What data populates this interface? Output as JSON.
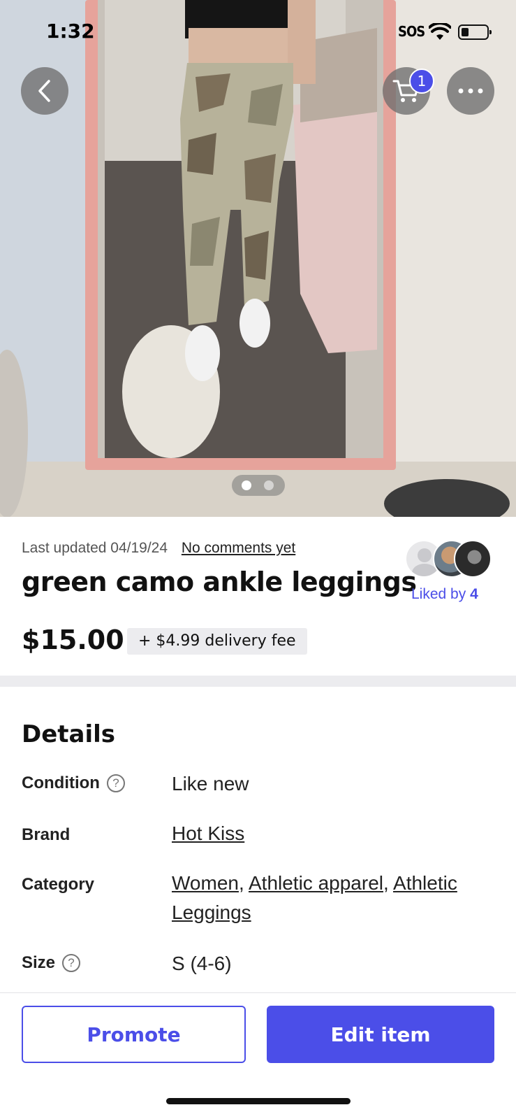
{
  "status_bar": {
    "time": "1:32",
    "sos": "SOS",
    "icons": [
      "wifi-icon",
      "battery-icon"
    ]
  },
  "photo": {
    "icons": {
      "back": "chevron-left-icon",
      "cart": "cart-icon",
      "more": "more-icon"
    },
    "cart_count": "1",
    "pager": {
      "count": 2,
      "active_index": 0
    }
  },
  "listing": {
    "last_updated": "Last updated 04/19/24",
    "comments": "No comments yet",
    "title": "green camo ankle leggings",
    "price": "$15.00",
    "delivery_fee": "+ $4.99 delivery fee",
    "liked_by_label": "Liked by",
    "liked_by_count": "4"
  },
  "details": {
    "heading": "Details",
    "condition_label": "Condition",
    "condition_value": "Like new",
    "brand_label": "Brand",
    "brand_value": "Hot Kiss",
    "category_label": "Category",
    "category_values": [
      "Women",
      "Athletic apparel",
      "Athletic Leggings"
    ],
    "category_separator": ", ",
    "size_label": "Size",
    "size_value": "S (4-6)",
    "help_glyph": "?"
  },
  "actions": {
    "promote": "Promote",
    "edit": "Edit item"
  },
  "colors": {
    "accent": "#4b4ee8",
    "divider": "#ececef",
    "mirror_frame": "#e6a39b"
  }
}
